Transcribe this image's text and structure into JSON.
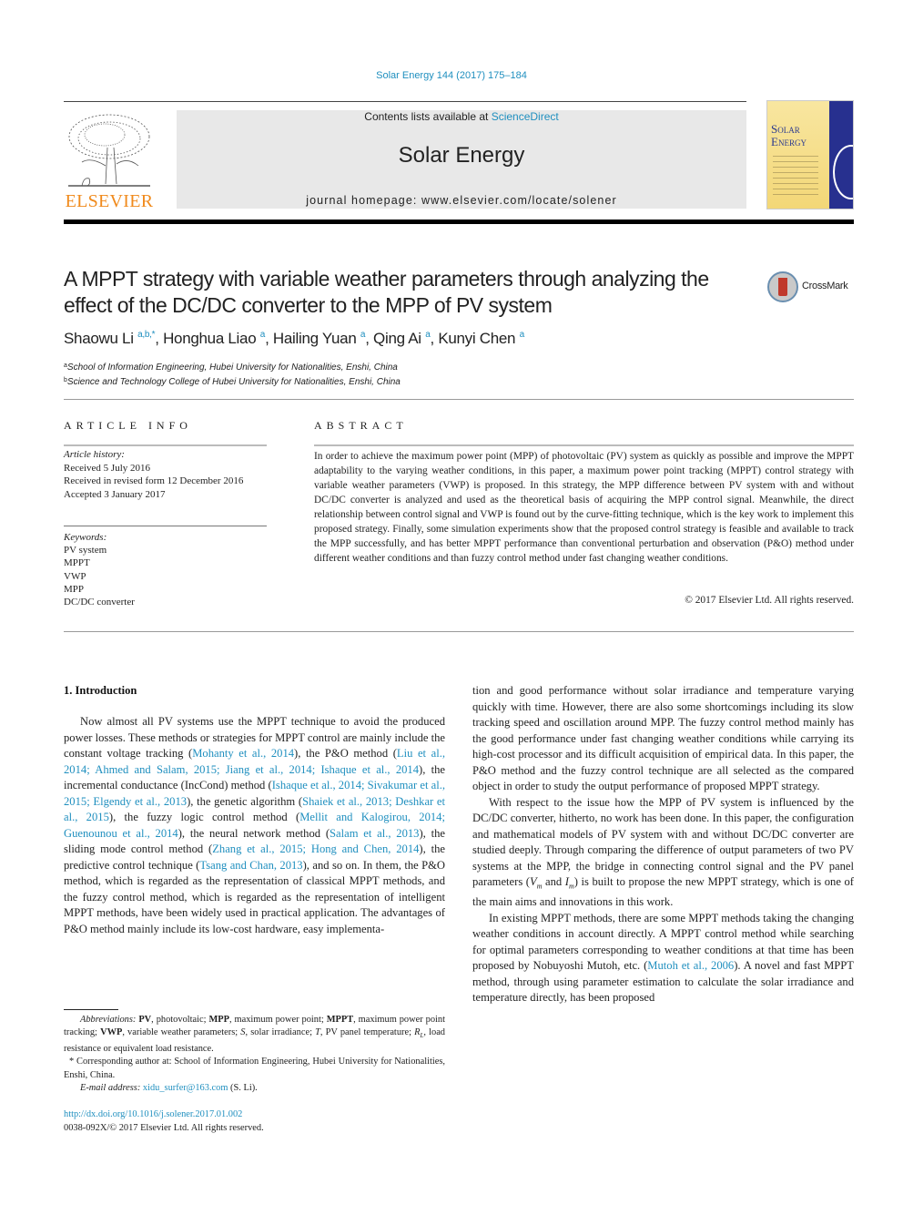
{
  "header": {
    "citation": "Solar Energy 144 (2017) 175–184",
    "contents_prefix": "Contents lists available at ",
    "contents_link": "ScienceDirect",
    "journal_name": "Solar Energy",
    "homepage": "journal homepage: www.elsevier.com/locate/solener",
    "publisher_logo_text": "ELSEVIER",
    "cover_title_line1": "Solar",
    "cover_title_line2": "Energy",
    "colors": {
      "link": "#1f8fbf",
      "elsevier_orange": "#f08a1c",
      "cover_yellow": "#f3d777",
      "cover_blue": "#27308f"
    }
  },
  "article": {
    "title": "A MPPT strategy with variable weather parameters through analyzing the effect of the DC/DC converter to the MPP of PV system",
    "crossmark_label": "CrossMark",
    "authors": [
      {
        "name": "Shaowu Li",
        "sup": "a,b,*"
      },
      {
        "name": "Honghua Liao",
        "sup": "a"
      },
      {
        "name": "Hailing Yuan",
        "sup": "a"
      },
      {
        "name": "Qing Ai",
        "sup": "a"
      },
      {
        "name": "Kunyi Chen",
        "sup": "a"
      }
    ],
    "affiliations": [
      {
        "mark": "a",
        "text": "School of Information Engineering, Hubei University for Nationalities, Enshi, China"
      },
      {
        "mark": "b",
        "text": "Science and Technology College of Hubei University for Nationalities, Enshi, China"
      }
    ]
  },
  "article_info": {
    "heading": "ARTICLE INFO",
    "history_label": "Article history:",
    "history": [
      "Received 5 July 2016",
      "Received in revised form 12 December 2016",
      "Accepted 3 January 2017"
    ],
    "keywords_label": "Keywords:",
    "keywords": [
      "PV system",
      "MPPT",
      "VWP",
      "MPP",
      "DC/DC converter"
    ]
  },
  "abstract": {
    "heading": "ABSTRACT",
    "text": "In order to achieve the maximum power point (MPP) of photovoltaic (PV) system as quickly as possible and improve the MPPT adaptability to the varying weather conditions, in this paper, a maximum power point tracking (MPPT) control strategy with variable weather parameters (VWP) is proposed. In this strategy, the MPP difference between PV system with and without DC/DC converter is analyzed and used as the theoretical basis of acquiring the MPP control signal. Meanwhile, the direct relationship between control signal and VWP is found out by the curve-fitting technique, which is the key work to implement this proposed strategy. Finally, some simulation experiments show that the proposed control strategy is feasible and available to track the MPP successfully, and has better MPPT performance than conventional perturbation and observation (P&O) method under different weather conditions and than fuzzy control method under fast changing weather conditions.",
    "copyright": "© 2017 Elsevier Ltd. All rights reserved."
  },
  "intro": {
    "heading": "1. Introduction",
    "left_para": [
      {
        "t": "Now almost all PV systems use the MPPT technique to avoid the produced power losses. These methods or strategies for MPPT control are mainly include the constant voltage tracking ("
      },
      {
        "l": "Mohanty et al., 2014"
      },
      {
        "t": "), the P&O method ("
      },
      {
        "l": "Liu et al., 2014; Ahmed and Salam, 2015; Jiang et al., 2014; Ishaque et al., 2014"
      },
      {
        "t": "), the incremental conductance (IncCond) method ("
      },
      {
        "l": "Ishaque et al., 2014; Sivakumar et al., 2015; Elgendy et al., 2013"
      },
      {
        "t": "), the genetic algorithm ("
      },
      {
        "l": "Shaiek et al., 2013; Deshkar et al., 2015"
      },
      {
        "t": "), the fuzzy logic control method ("
      },
      {
        "l": "Mellit and Kalogirou, 2014; Guenounou et al., 2014"
      },
      {
        "t": "), the neural network method ("
      },
      {
        "l": "Salam et al., 2013"
      },
      {
        "t": "), the sliding mode control method ("
      },
      {
        "l": "Zhang et al., 2015; Hong and Chen, 2014"
      },
      {
        "t": "), the predictive control technique ("
      },
      {
        "l": "Tsang and Chan, 2013"
      },
      {
        "t": "), and so on. In them, the P&O method, which is regarded as the representation of classical MPPT methods, and the fuzzy control method, which is regarded as the representation of intelligent MPPT methods, have been widely used in practical application. The advantages of P&O method mainly include its low-cost hardware, easy implementa-"
      }
    ],
    "right_para_1": "tion and good performance without solar irradiance and temperature varying quickly with time. However, there are also some shortcomings including its slow tracking speed and oscillation around MPP. The fuzzy control method mainly has the good performance under fast changing weather conditions while carrying its high-cost processor and its difficult acquisition of empirical data. In this paper, the P&O method and the fuzzy control technique are all selected as the compared object in order to study the output performance of proposed MPPT strategy.",
    "right_para_2_a": "With respect to the issue how the MPP of PV system is influenced by the DC/DC converter, hitherto, no work has been done. In this paper, the configuration and mathematical models of PV system with and without DC/DC converter are studied deeply. Through comparing the difference of output parameters of two PV systems at the MPP, the bridge in connecting control signal and the PV panel parameters (",
    "vm": "V",
    "vm_sub": "m",
    "and": " and ",
    "im": "I",
    "im_sub": "m",
    "right_para_2_b": ") is built to propose the new MPPT strategy, which is one of the main aims and innovations in this work.",
    "right_para_3_a": "In existing MPPT methods, there are some MPPT methods taking the changing weather conditions in account directly. A MPPT control method while searching for optimal parameters corresponding to weather conditions at that time has been proposed by Nobuyoshi Mutoh, etc. (",
    "right_para_3_link": "Mutoh et al., 2006",
    "right_para_3_b": "). A novel and fast MPPT method, through using parameter estimation to calculate the solar irradiance and temperature directly, has been proposed"
  },
  "footnotes": {
    "abbrev_label": "Abbreviations:",
    "abbrev": [
      {
        "b": "PV",
        "t": ", photovoltaic; "
      },
      {
        "b": "MPP",
        "t": ", maximum power point; "
      },
      {
        "b": "MPPT",
        "t": ", maximum power point tracking; "
      },
      {
        "b": "VWP",
        "t": ", variable weather parameters; "
      },
      {
        "i": "S",
        "t": ", solar irradiance; "
      },
      {
        "i": "T",
        "t": ", PV panel temperature; "
      },
      {
        "i": "R",
        "sub": "L",
        "t": ", load resistance or equivalent load resistance."
      }
    ],
    "corresponding": "* Corresponding author at: School of Information Engineering, Hubei University for Nationalities, Enshi, China.",
    "email_label": "E-mail address:",
    "email": "xidu_surfer@163.com",
    "email_suffix": " (S. Li).",
    "doi": "http://dx.doi.org/10.1016/j.solener.2017.01.002",
    "issn_copyright": "0038-092X/© 2017 Elsevier Ltd. All rights reserved."
  }
}
